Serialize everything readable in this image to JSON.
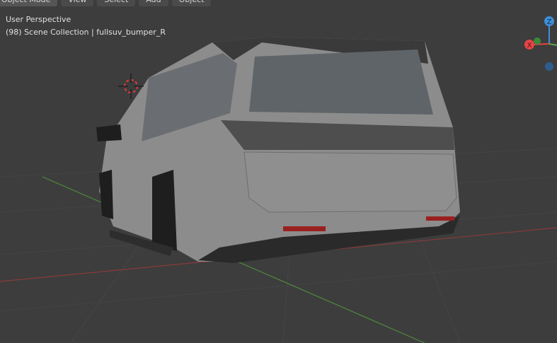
{
  "header": {
    "mode": "Object Mode",
    "menus": [
      "View",
      "Select",
      "Add",
      "Object"
    ]
  },
  "overlay": {
    "view_name": "User Perspective",
    "collection_info": "(98) Scene Collection | fullsuv_bumper_R"
  },
  "gizmo": {
    "z": "Z",
    "x": "X"
  },
  "colors": {
    "background": "#3d3d3d",
    "x_axis": "#e64545",
    "y_axis": "#5ea84a",
    "z_axis": "#3f8ed8"
  }
}
